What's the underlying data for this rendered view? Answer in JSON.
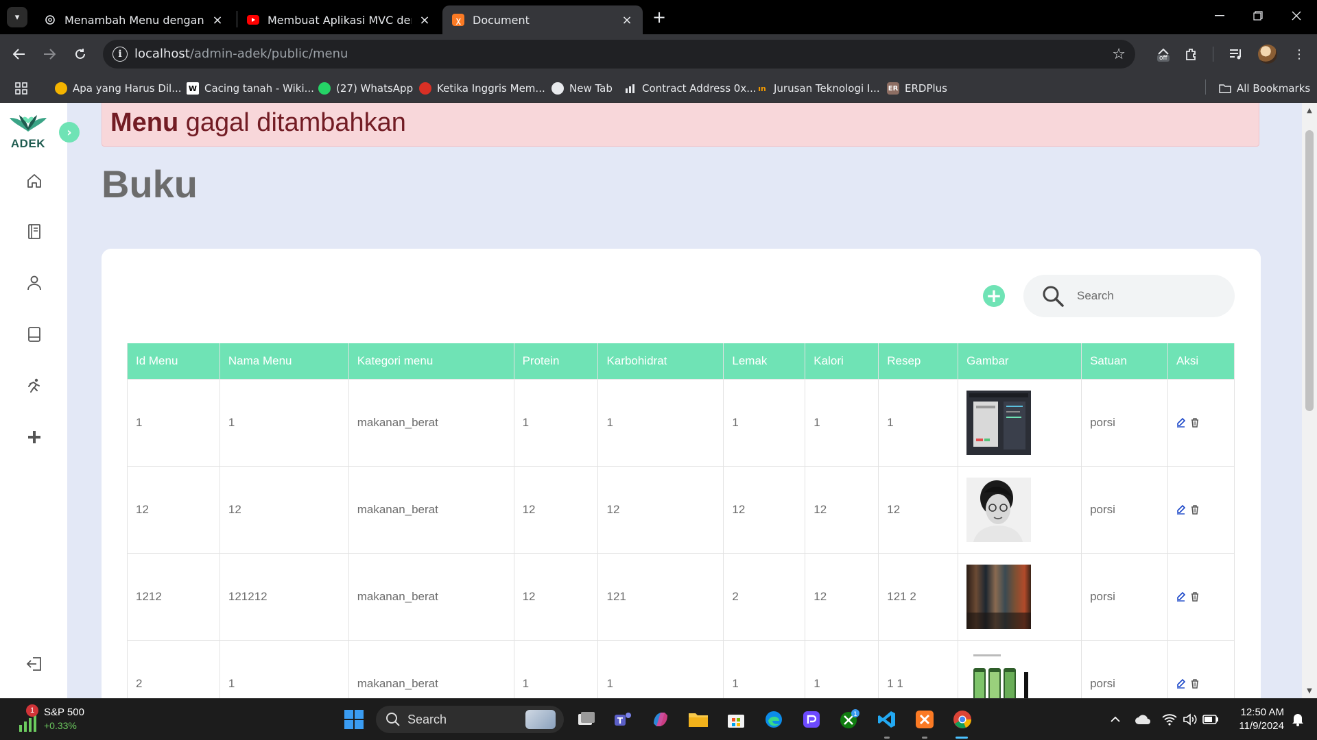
{
  "browser": {
    "tabs": [
      {
        "title": "Menambah Menu dengan Alert",
        "close": "×"
      },
      {
        "title": "Membuat Aplikasi MVC dengan",
        "close": "×"
      },
      {
        "title": "Document",
        "close": "×"
      }
    ],
    "new_tab": "+",
    "url_host": "localhost",
    "url_path": "/admin-adek/public/menu",
    "extension_badge": "off",
    "bookmarks": [
      {
        "label": "Apa yang Harus Dil...",
        "color": "#f4b400"
      },
      {
        "label": "Cacing tanah - Wiki...",
        "icon_text": "W",
        "color": "#ffffff"
      },
      {
        "label": "(27) WhatsApp",
        "color": "#25d366"
      },
      {
        "label": "Ketika Inggris Mem...",
        "color": "#d93025"
      },
      {
        "label": "New Tab",
        "color": "#e8eaed"
      },
      {
        "label": "Contract Address 0x...",
        "color": "#e8eaed"
      },
      {
        "label": "Jurusan Teknologi I...",
        "color": "#f29900"
      },
      {
        "label": "ERDPlus",
        "icon_text": "ER",
        "color": "#8d6e63"
      }
    ],
    "all_bookmarks": "All Bookmarks"
  },
  "sidebar": {
    "logo_text": "ADEK",
    "items": [
      {
        "icon": "home-icon"
      },
      {
        "icon": "book-icon"
      },
      {
        "icon": "user-icon"
      },
      {
        "icon": "tablet-icon"
      },
      {
        "icon": "running-icon"
      },
      {
        "icon": "plus-icon"
      }
    ],
    "logout_icon": "logout-icon"
  },
  "alert": {
    "bold": "Menu",
    "text": " gagal ditambahkan",
    "color": "#721c24"
  },
  "page_title": "Buku",
  "search": {
    "placeholder": "Search"
  },
  "table": {
    "headers": [
      "Id Menu",
      "Nama Menu",
      "Kategori menu",
      "Protein",
      "Karbohidrat",
      "Lemak",
      "Kalori",
      "Resep",
      "Gambar",
      "Satuan",
      "Aksi"
    ],
    "rows": [
      {
        "id": "1",
        "nama": "1",
        "kategori": "makanan_berat",
        "protein": "1",
        "karbohidrat": "1",
        "lemak": "1",
        "kalori": "1",
        "resep": "1",
        "gambar": "screenshot",
        "satuan": "porsi"
      },
      {
        "id": "12",
        "nama": "12",
        "kategori": "makanan_berat",
        "protein": "12",
        "karbohidrat": "12",
        "lemak": "12",
        "kalori": "12",
        "resep": "12",
        "gambar": "portrait",
        "satuan": "porsi"
      },
      {
        "id": "1212",
        "nama": "121212",
        "kategori": "makanan_berat",
        "protein": "12",
        "karbohidrat": "121",
        "lemak": "2",
        "kalori": "12",
        "resep": "121 2",
        "gambar": "blur",
        "satuan": "porsi"
      },
      {
        "id": "2",
        "nama": "1",
        "kategori": "makanan_berat",
        "protein": "1",
        "karbohidrat": "1",
        "lemak": "1",
        "kalori": "1",
        "resep": "1 1",
        "gambar": "phones",
        "satuan": "porsi"
      }
    ]
  },
  "colors": {
    "accent": "#6fe3b5",
    "page_bg": "#e3e8f6",
    "alert_bg": "#f8d7da"
  },
  "taskbar": {
    "widget_name": "S&P 500",
    "widget_value": "+0.33%",
    "widget_badge": "1",
    "search_label": "Search",
    "xbox_badge": "1",
    "time": "12:50 AM",
    "date": "11/9/2024"
  }
}
